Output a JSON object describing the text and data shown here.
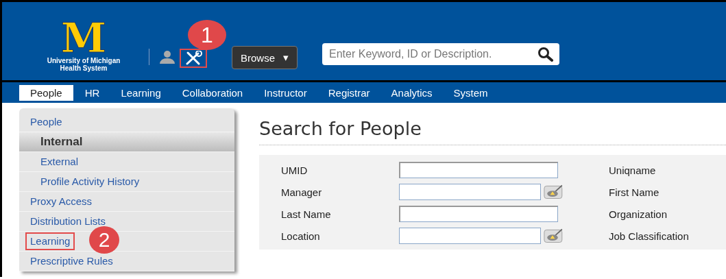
{
  "header": {
    "logo_letter": "M",
    "logo_text": [
      "University of Michigan",
      "Health System"
    ],
    "tools_button": {
      "highlighted": true,
      "callout": "1"
    },
    "browse_button": {
      "label": "Browse",
      "caret": "▾"
    },
    "search": {
      "placeholder": "Enter Keyword, ID or Description."
    }
  },
  "nav": [
    {
      "label": "People",
      "selected": true
    },
    {
      "label": "HR",
      "selected": false
    },
    {
      "label": "Learning",
      "selected": false
    },
    {
      "label": "Collaboration",
      "selected": false
    },
    {
      "label": "Instructor",
      "selected": false
    },
    {
      "label": "Registrar",
      "selected": false
    },
    {
      "label": "Analytics",
      "selected": false
    },
    {
      "label": "System",
      "selected": false
    }
  ],
  "sidebar": {
    "items": [
      {
        "label": "People",
        "selected": false,
        "highlighted": false,
        "children": [
          {
            "label": "Internal",
            "selected": true
          },
          {
            "label": "External",
            "selected": false
          },
          {
            "label": "Profile Activity History",
            "selected": false
          }
        ]
      },
      {
        "label": "Proxy Access",
        "selected": false,
        "highlighted": false
      },
      {
        "label": "Distribution Lists",
        "selected": false,
        "highlighted": false
      },
      {
        "label": "Learning",
        "selected": false,
        "highlighted": true,
        "callout": "2"
      },
      {
        "label": "Prescriptive Rules",
        "selected": false,
        "highlighted": false
      }
    ]
  },
  "main": {
    "title": "Search for People",
    "fields": [
      {
        "label": "UMID",
        "lookup": false,
        "right_label": "Uniqname"
      },
      {
        "label": "Manager",
        "lookup": true,
        "right_label": "First Name"
      },
      {
        "label": "Last Name",
        "lookup": false,
        "right_label": "Organization"
      },
      {
        "label": "Location",
        "lookup": true,
        "right_label": "Job Classification"
      }
    ]
  }
}
